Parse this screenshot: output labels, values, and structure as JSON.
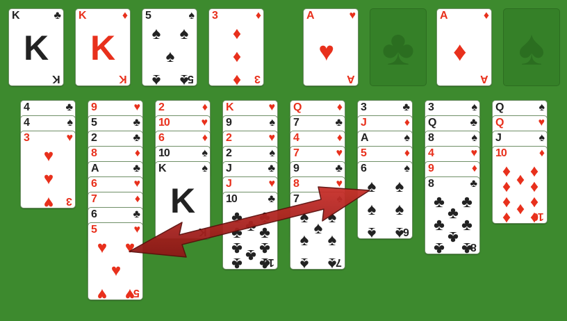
{
  "game": "FreeCell",
  "colors": {
    "felt": "#3d8a2e",
    "red_suit": "#e8301c",
    "black_suit": "#222222",
    "arrow": "#b52321"
  },
  "free_cells": [
    {
      "rank": "K",
      "suit": "♣",
      "color": "black"
    },
    {
      "rank": "K",
      "suit": "♦",
      "color": "red"
    },
    {
      "rank": "5",
      "suit": "♠",
      "color": "black"
    },
    {
      "rank": "3",
      "suit": "♦",
      "color": "red"
    }
  ],
  "foundations": [
    {
      "rank": "A",
      "suit": "♥",
      "color": "red",
      "empty": false
    },
    {
      "rank": "",
      "suit": "♣",
      "empty": true,
      "icon": "club-icon"
    },
    {
      "rank": "A",
      "suit": "♦",
      "color": "red",
      "empty": false
    },
    {
      "rank": "",
      "suit": "♠",
      "empty": true,
      "icon": "spade-icon"
    }
  ],
  "tableau": [
    [
      {
        "rank": "4",
        "suit": "♣"
      },
      {
        "rank": "4",
        "suit": "♠"
      },
      {
        "rank": "3",
        "suit": "♥"
      }
    ],
    [
      {
        "rank": "9",
        "suit": "♥"
      },
      {
        "rank": "5",
        "suit": "♣"
      },
      {
        "rank": "2",
        "suit": "♣"
      },
      {
        "rank": "8",
        "suit": "♦"
      },
      {
        "rank": "A",
        "suit": "♣"
      },
      {
        "rank": "6",
        "suit": "♥"
      },
      {
        "rank": "7",
        "suit": "♦"
      },
      {
        "rank": "6",
        "suit": "♣"
      },
      {
        "rank": "5",
        "suit": "♥"
      }
    ],
    [
      {
        "rank": "2",
        "suit": "♦"
      },
      {
        "rank": "10",
        "suit": "♥"
      },
      {
        "rank": "6",
        "suit": "♦"
      },
      {
        "rank": "10",
        "suit": "♠"
      },
      {
        "rank": "K",
        "suit": "♠"
      }
    ],
    [
      {
        "rank": "K",
        "suit": "♥"
      },
      {
        "rank": "9",
        "suit": "♠"
      },
      {
        "rank": "2",
        "suit": "♥"
      },
      {
        "rank": "2",
        "suit": "♠"
      },
      {
        "rank": "J",
        "suit": "♣"
      },
      {
        "rank": "J",
        "suit": "♥"
      },
      {
        "rank": "10",
        "suit": "♣"
      }
    ],
    [
      {
        "rank": "Q",
        "suit": "♦"
      },
      {
        "rank": "7",
        "suit": "♣"
      },
      {
        "rank": "4",
        "suit": "♦"
      },
      {
        "rank": "7",
        "suit": "♥"
      },
      {
        "rank": "9",
        "suit": "♣"
      },
      {
        "rank": "8",
        "suit": "♥"
      },
      {
        "rank": "7",
        "suit": "♠"
      }
    ],
    [
      {
        "rank": "3",
        "suit": "♣"
      },
      {
        "rank": "J",
        "suit": "♦"
      },
      {
        "rank": "A",
        "suit": "♠"
      },
      {
        "rank": "5",
        "suit": "♦"
      },
      {
        "rank": "6",
        "suit": "♠"
      }
    ],
    [
      {
        "rank": "3",
        "suit": "♠"
      },
      {
        "rank": "Q",
        "suit": "♣"
      },
      {
        "rank": "8",
        "suit": "♠"
      },
      {
        "rank": "4",
        "suit": "♥"
      },
      {
        "rank": "9",
        "suit": "♦"
      },
      {
        "rank": "8",
        "suit": "♣"
      }
    ],
    [
      {
        "rank": "Q",
        "suit": "♠"
      },
      {
        "rank": "Q",
        "suit": "♥"
      },
      {
        "rank": "J",
        "suit": "♠"
      },
      {
        "rank": "10",
        "suit": "♦"
      }
    ]
  ],
  "hint_arrow": {
    "from": "tableau column 2 bottom card (5♥)",
    "to": "tableau column 6 bottom card (6♠)",
    "bidirectional": true
  }
}
